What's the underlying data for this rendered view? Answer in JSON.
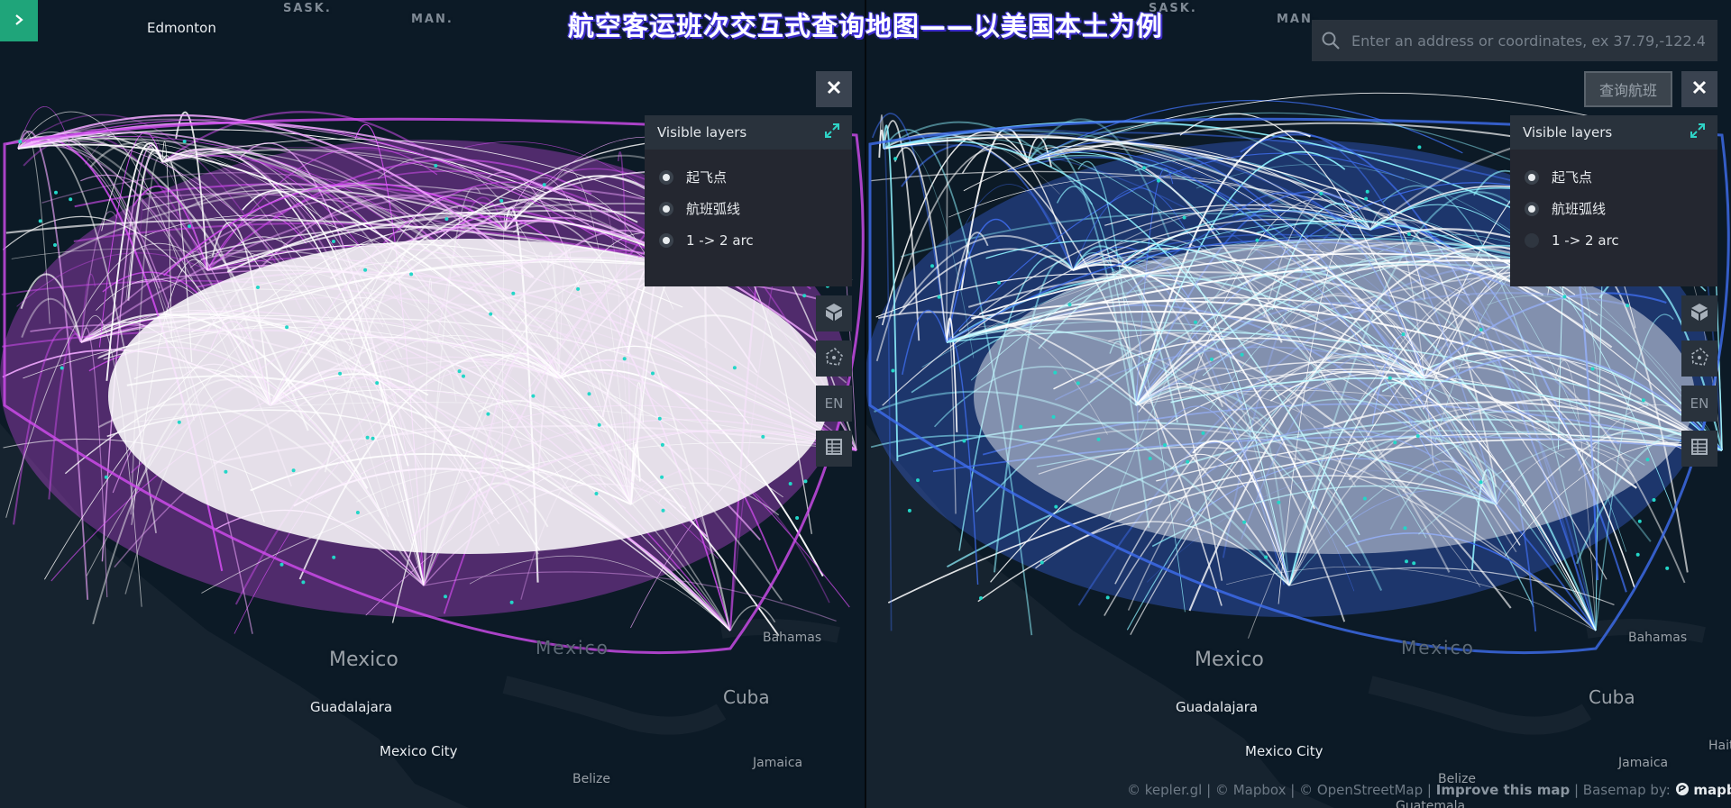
{
  "title": "航空客运班次交互式查询地图——以美国本土为例",
  "search": {
    "placeholder": "Enter an address or coordinates, ex 37.79,-122.4"
  },
  "query_button": "查询航班",
  "layer_panel": {
    "title": "Visible layers",
    "layers": [
      {
        "label": "起飞点",
        "visible_left": true,
        "visible_right": true
      },
      {
        "label": "航班弧线",
        "visible_left": true,
        "visible_right": true
      },
      {
        "label": "1 -> 2 arc",
        "visible_left": true,
        "visible_right": false
      }
    ]
  },
  "map_controls": {
    "lang": "EN"
  },
  "places": {
    "edmonton": "Edmonton",
    "sask": "SASK.",
    "man": "MAN.",
    "mexico": "Mexico",
    "mexico_ghost": "Mexico",
    "guadalajara": "Guadalajara",
    "mexico_city": "Mexico City",
    "cuba": "Cuba",
    "bahamas": "Bahamas",
    "jamaica": "Jamaica",
    "belize": "Belize",
    "guatemala": "Guatemala",
    "haiti": "Haiti"
  },
  "attribution": {
    "kepler": "© kepler.gl",
    "mapbox": "© Mapbox",
    "osm": "© OpenStreetMap",
    "improve": "Improve this map",
    "basemap": "Basemap by:",
    "logo": "mapbox"
  },
  "colors": {
    "left_arc": "#d24cf0",
    "right_arc": "#3f6ef0",
    "right_arc_light": "#8ff3ff",
    "accent_green": "#1fa57a",
    "point_cyan": "#23d6c8"
  },
  "icons": [
    "chevron-right-icon",
    "search-icon",
    "close-icon",
    "layer-toggle-icon",
    "3d-cube-icon",
    "draw-polygon-icon",
    "table-icon",
    "mapbox-logo-icon"
  ]
}
